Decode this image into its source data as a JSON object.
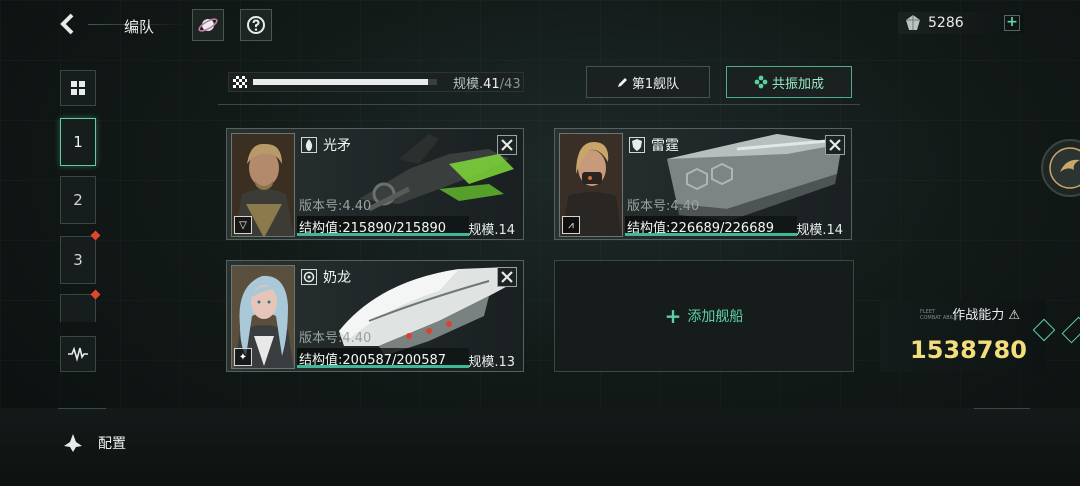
{
  "header": {
    "title": "编队",
    "back_icon": "chevron-left-icon",
    "planet_icon": "planet-icon",
    "help_icon": "help-icon"
  },
  "currency": {
    "icon": "crystal-icon",
    "value": "5286",
    "plus": "+"
  },
  "sidebar": {
    "grid_icon": "grid-icon",
    "tabs": [
      {
        "label": "1",
        "active": true,
        "alert": false
      },
      {
        "label": "2",
        "active": false,
        "alert": false
      },
      {
        "label": "3",
        "active": false,
        "alert": true
      },
      {
        "label": "",
        "active": false,
        "alert": true
      }
    ],
    "bottom_icon": "waveform-icon"
  },
  "scale_progress": {
    "label": "规模.",
    "current": "41",
    "separator": "/",
    "max": "43",
    "fraction": 0.953
  },
  "fleet_button": {
    "label": "第1舰队",
    "icon": "pencil-icon"
  },
  "resonance_button": {
    "label": "共振加成",
    "icon": "flower-icon"
  },
  "ships": [
    {
      "name": "光矛",
      "version": "版本号:4.40",
      "hp_label": "结构值:215890/215890",
      "hp_fraction": 1.0,
      "scale": "规模.14",
      "rank": "▽",
      "type_icon": "flame-icon",
      "hair": "#b89a6a",
      "skin": "#b38a6c"
    },
    {
      "name": "雷霆",
      "version": "版本号:4.40",
      "hp_label": "结构值:226689/226689",
      "hp_fraction": 1.0,
      "scale": "规模.14",
      "rank": "⩘",
      "type_icon": "shield-icon",
      "hair": "#c9a56b",
      "skin": "#c89a7c"
    },
    {
      "name": "奶龙",
      "version": "版本号:4.40",
      "hp_label": "结构值:200587/200587",
      "hp_fraction": 1.0,
      "scale": "规模.13",
      "rank": "✦",
      "type_icon": "target-icon",
      "hair": "#a9c8d8",
      "skin": "#e6c5b8"
    }
  ],
  "empty_slot": {
    "plus": "+",
    "label": "添加舰船"
  },
  "combat": {
    "label": "作战能力",
    "sub1": "FLEET",
    "sub2": "COMBAT ABILITY",
    "value": "1538780"
  },
  "config": {
    "label": "配置",
    "icon": "ship-icon"
  },
  "colors": {
    "accent_green": "#5ecfa3",
    "gold": "#f3dd7c",
    "alert": "#e0462c"
  }
}
